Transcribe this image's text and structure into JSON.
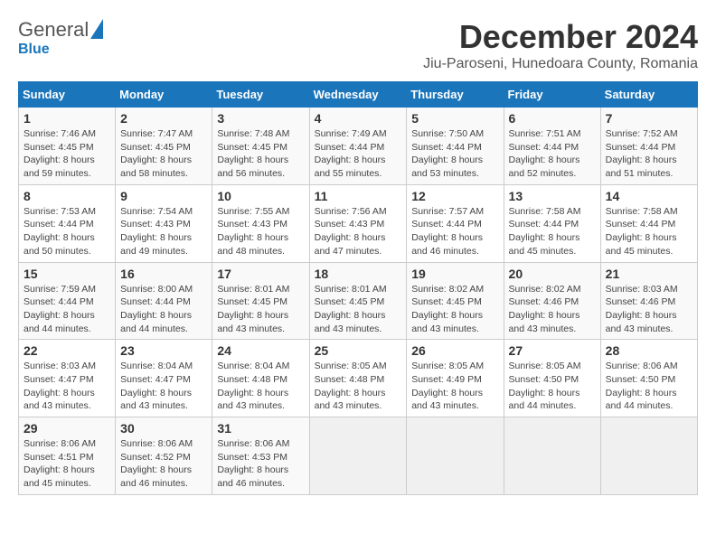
{
  "logo": {
    "general": "General",
    "blue": "Blue"
  },
  "title": "December 2024",
  "subtitle": "Jiu-Paroseni, Hunedoara County, Romania",
  "days_of_week": [
    "Sunday",
    "Monday",
    "Tuesday",
    "Wednesday",
    "Thursday",
    "Friday",
    "Saturday"
  ],
  "weeks": [
    [
      {
        "day": "1",
        "info": "Sunrise: 7:46 AM\nSunset: 4:45 PM\nDaylight: 8 hours and 59 minutes."
      },
      {
        "day": "2",
        "info": "Sunrise: 7:47 AM\nSunset: 4:45 PM\nDaylight: 8 hours and 58 minutes."
      },
      {
        "day": "3",
        "info": "Sunrise: 7:48 AM\nSunset: 4:45 PM\nDaylight: 8 hours and 56 minutes."
      },
      {
        "day": "4",
        "info": "Sunrise: 7:49 AM\nSunset: 4:44 PM\nDaylight: 8 hours and 55 minutes."
      },
      {
        "day": "5",
        "info": "Sunrise: 7:50 AM\nSunset: 4:44 PM\nDaylight: 8 hours and 53 minutes."
      },
      {
        "day": "6",
        "info": "Sunrise: 7:51 AM\nSunset: 4:44 PM\nDaylight: 8 hours and 52 minutes."
      },
      {
        "day": "7",
        "info": "Sunrise: 7:52 AM\nSunset: 4:44 PM\nDaylight: 8 hours and 51 minutes."
      }
    ],
    [
      {
        "day": "8",
        "info": "Sunrise: 7:53 AM\nSunset: 4:44 PM\nDaylight: 8 hours and 50 minutes."
      },
      {
        "day": "9",
        "info": "Sunrise: 7:54 AM\nSunset: 4:43 PM\nDaylight: 8 hours and 49 minutes."
      },
      {
        "day": "10",
        "info": "Sunrise: 7:55 AM\nSunset: 4:43 PM\nDaylight: 8 hours and 48 minutes."
      },
      {
        "day": "11",
        "info": "Sunrise: 7:56 AM\nSunset: 4:43 PM\nDaylight: 8 hours and 47 minutes."
      },
      {
        "day": "12",
        "info": "Sunrise: 7:57 AM\nSunset: 4:44 PM\nDaylight: 8 hours and 46 minutes."
      },
      {
        "day": "13",
        "info": "Sunrise: 7:58 AM\nSunset: 4:44 PM\nDaylight: 8 hours and 45 minutes."
      },
      {
        "day": "14",
        "info": "Sunrise: 7:58 AM\nSunset: 4:44 PM\nDaylight: 8 hours and 45 minutes."
      }
    ],
    [
      {
        "day": "15",
        "info": "Sunrise: 7:59 AM\nSunset: 4:44 PM\nDaylight: 8 hours and 44 minutes."
      },
      {
        "day": "16",
        "info": "Sunrise: 8:00 AM\nSunset: 4:44 PM\nDaylight: 8 hours and 44 minutes."
      },
      {
        "day": "17",
        "info": "Sunrise: 8:01 AM\nSunset: 4:45 PM\nDaylight: 8 hours and 43 minutes."
      },
      {
        "day": "18",
        "info": "Sunrise: 8:01 AM\nSunset: 4:45 PM\nDaylight: 8 hours and 43 minutes."
      },
      {
        "day": "19",
        "info": "Sunrise: 8:02 AM\nSunset: 4:45 PM\nDaylight: 8 hours and 43 minutes."
      },
      {
        "day": "20",
        "info": "Sunrise: 8:02 AM\nSunset: 4:46 PM\nDaylight: 8 hours and 43 minutes."
      },
      {
        "day": "21",
        "info": "Sunrise: 8:03 AM\nSunset: 4:46 PM\nDaylight: 8 hours and 43 minutes."
      }
    ],
    [
      {
        "day": "22",
        "info": "Sunrise: 8:03 AM\nSunset: 4:47 PM\nDaylight: 8 hours and 43 minutes."
      },
      {
        "day": "23",
        "info": "Sunrise: 8:04 AM\nSunset: 4:47 PM\nDaylight: 8 hours and 43 minutes."
      },
      {
        "day": "24",
        "info": "Sunrise: 8:04 AM\nSunset: 4:48 PM\nDaylight: 8 hours and 43 minutes."
      },
      {
        "day": "25",
        "info": "Sunrise: 8:05 AM\nSunset: 4:48 PM\nDaylight: 8 hours and 43 minutes."
      },
      {
        "day": "26",
        "info": "Sunrise: 8:05 AM\nSunset: 4:49 PM\nDaylight: 8 hours and 43 minutes."
      },
      {
        "day": "27",
        "info": "Sunrise: 8:05 AM\nSunset: 4:50 PM\nDaylight: 8 hours and 44 minutes."
      },
      {
        "day": "28",
        "info": "Sunrise: 8:06 AM\nSunset: 4:50 PM\nDaylight: 8 hours and 44 minutes."
      }
    ],
    [
      {
        "day": "29",
        "info": "Sunrise: 8:06 AM\nSunset: 4:51 PM\nDaylight: 8 hours and 45 minutes."
      },
      {
        "day": "30",
        "info": "Sunrise: 8:06 AM\nSunset: 4:52 PM\nDaylight: 8 hours and 46 minutes."
      },
      {
        "day": "31",
        "info": "Sunrise: 8:06 AM\nSunset: 4:53 PM\nDaylight: 8 hours and 46 minutes."
      },
      null,
      null,
      null,
      null
    ]
  ]
}
